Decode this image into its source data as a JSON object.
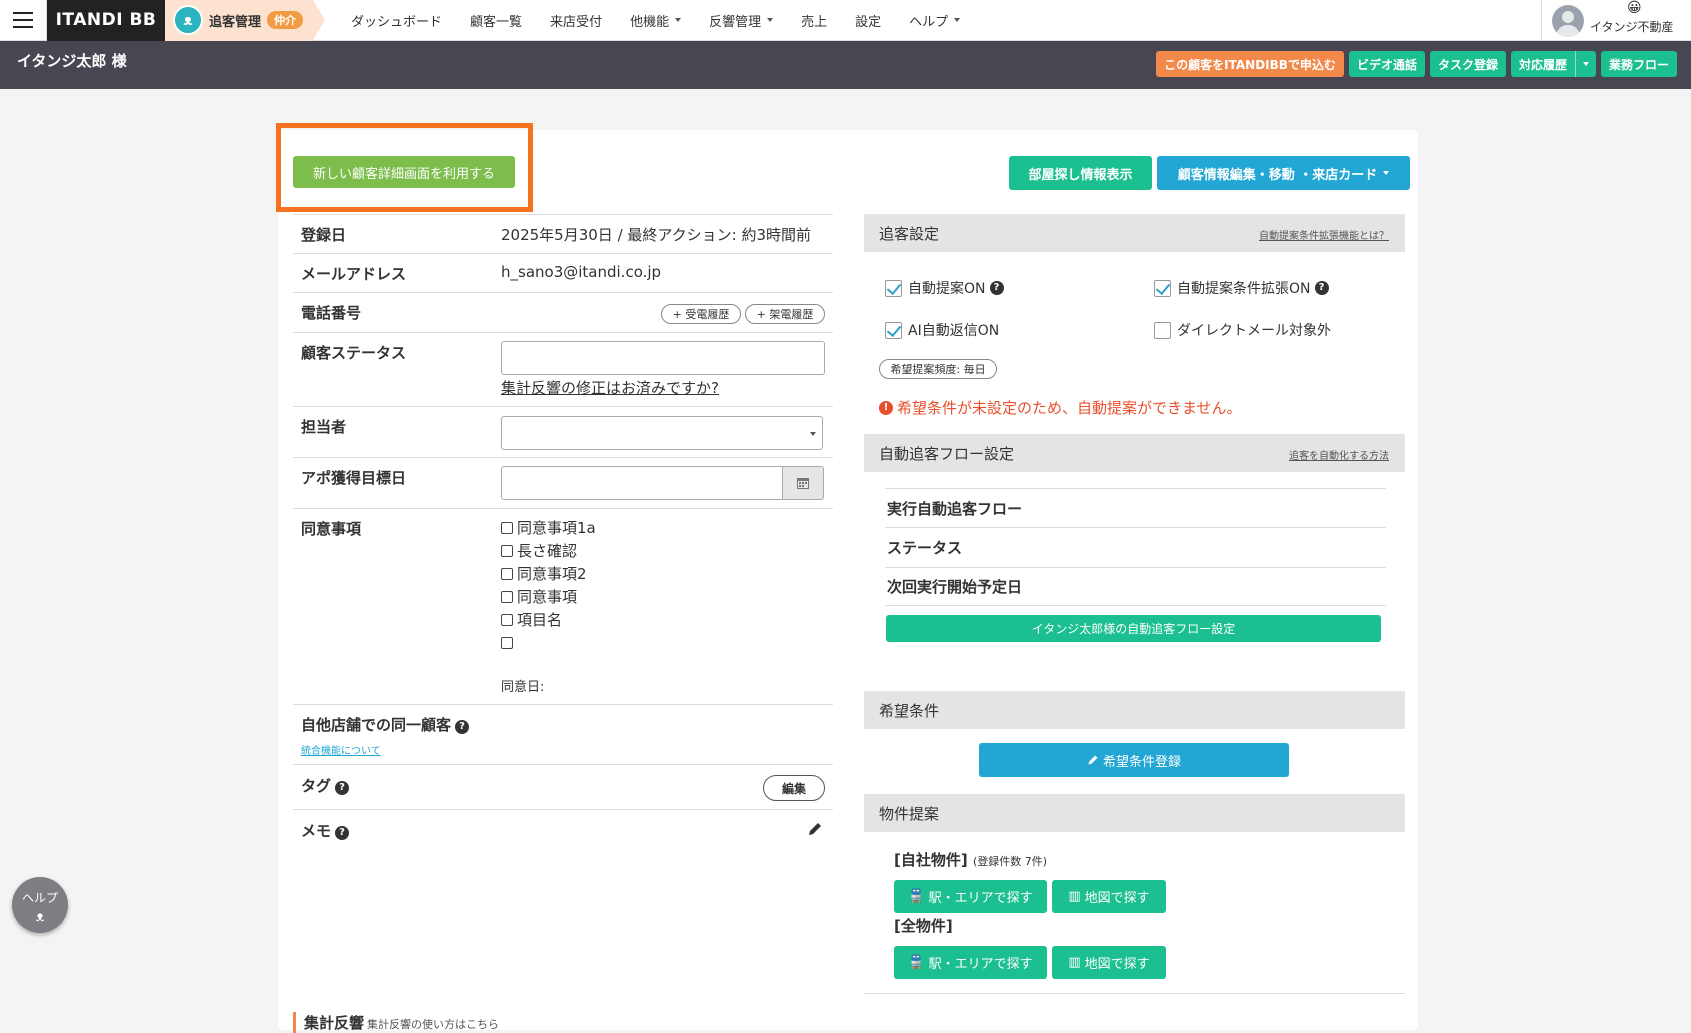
{
  "topnav": {
    "logo": "ITANDI BB",
    "module_label": "追客管理",
    "module_badge": "仲介",
    "items": [
      "ダッシュボード",
      "顧客一覧",
      "来店受付",
      "他機能",
      "反響管理",
      "売上",
      "設定",
      "ヘルプ"
    ],
    "user_name": "イタンジ不動産",
    "user_emoji": "😀"
  },
  "subbar": {
    "customer_name": "イタンジ太郎 様",
    "btn_apply": "この顧客をITANDIBBで申込む",
    "btn_video": "ビデオ通話",
    "btn_task": "タスク登録",
    "btn_history": "対応履歴",
    "btn_flow": "業務フロー"
  },
  "main": {
    "btn_new_detail": "新しい顧客詳細画面を利用する",
    "btn_room_search": "部屋探し情報表示",
    "btn_edit": "顧客情報編集・移動 ・来店カード"
  },
  "details": {
    "reg_label": "登録日",
    "reg_value": "2025年5月30日 / 最終アクション: 約3時間前",
    "email_label": "メールアドレス",
    "email_value": "h_sano3@itandi.co.jp",
    "phone_label": "電話番号",
    "btn_incoming": "+ 受電履歴",
    "btn_outgoing": "+ 架電履歴",
    "status_label": "顧客ステータス",
    "status_link": "集計反響の修正はお済みですか?",
    "staff_label": "担当者",
    "appo_label": "アポ獲得目標日",
    "consent_label": "同意事項",
    "consent_items": [
      "同意事項1a",
      "長さ確認",
      "同意事項2",
      "同意事項",
      "項目名",
      ""
    ],
    "consent_date_label": "同意日:",
    "same_cust_label": "自他店舗での同一顧客",
    "merge_link": "統合機能について",
    "tag_label": "タグ",
    "tag_edit": "編集",
    "memo_label": "メモ"
  },
  "tracking": {
    "title": "追客設定",
    "link": "自動提案条件拡張機能とは？",
    "auto_proposal": "自動提案ON",
    "auto_proposal_ext": "自動提案条件拡張ON",
    "ai_reply": "AI自動返信ON",
    "dm_exclude": "ダイレクトメール対象外",
    "frequency": "希望提案頻度: 毎日",
    "warning": "希望条件が未設定のため、自動提案ができません。"
  },
  "autoflow": {
    "title": "自動追客フロー設定",
    "link": "追客を自動化する方法",
    "row1": "実行自動追客フロー",
    "row2": "ステータス",
    "row3": "次回実行開始予定日",
    "btn": "イタンジ太郎様の自動追客フロー設定"
  },
  "desired": {
    "title": "希望条件",
    "btn": "希望条件登録"
  },
  "proposal": {
    "title": "物件提案",
    "own_label": "[自社物件]",
    "own_count": "(登録件数 7件)",
    "all_label": "[全物件]",
    "btn_station": "駅・エリアで探す",
    "btn_map": "地図で探す"
  },
  "footer": {
    "section": "集計反響",
    "section_link": "集計反響の使い方はこちら",
    "help": "ヘルプ"
  }
}
